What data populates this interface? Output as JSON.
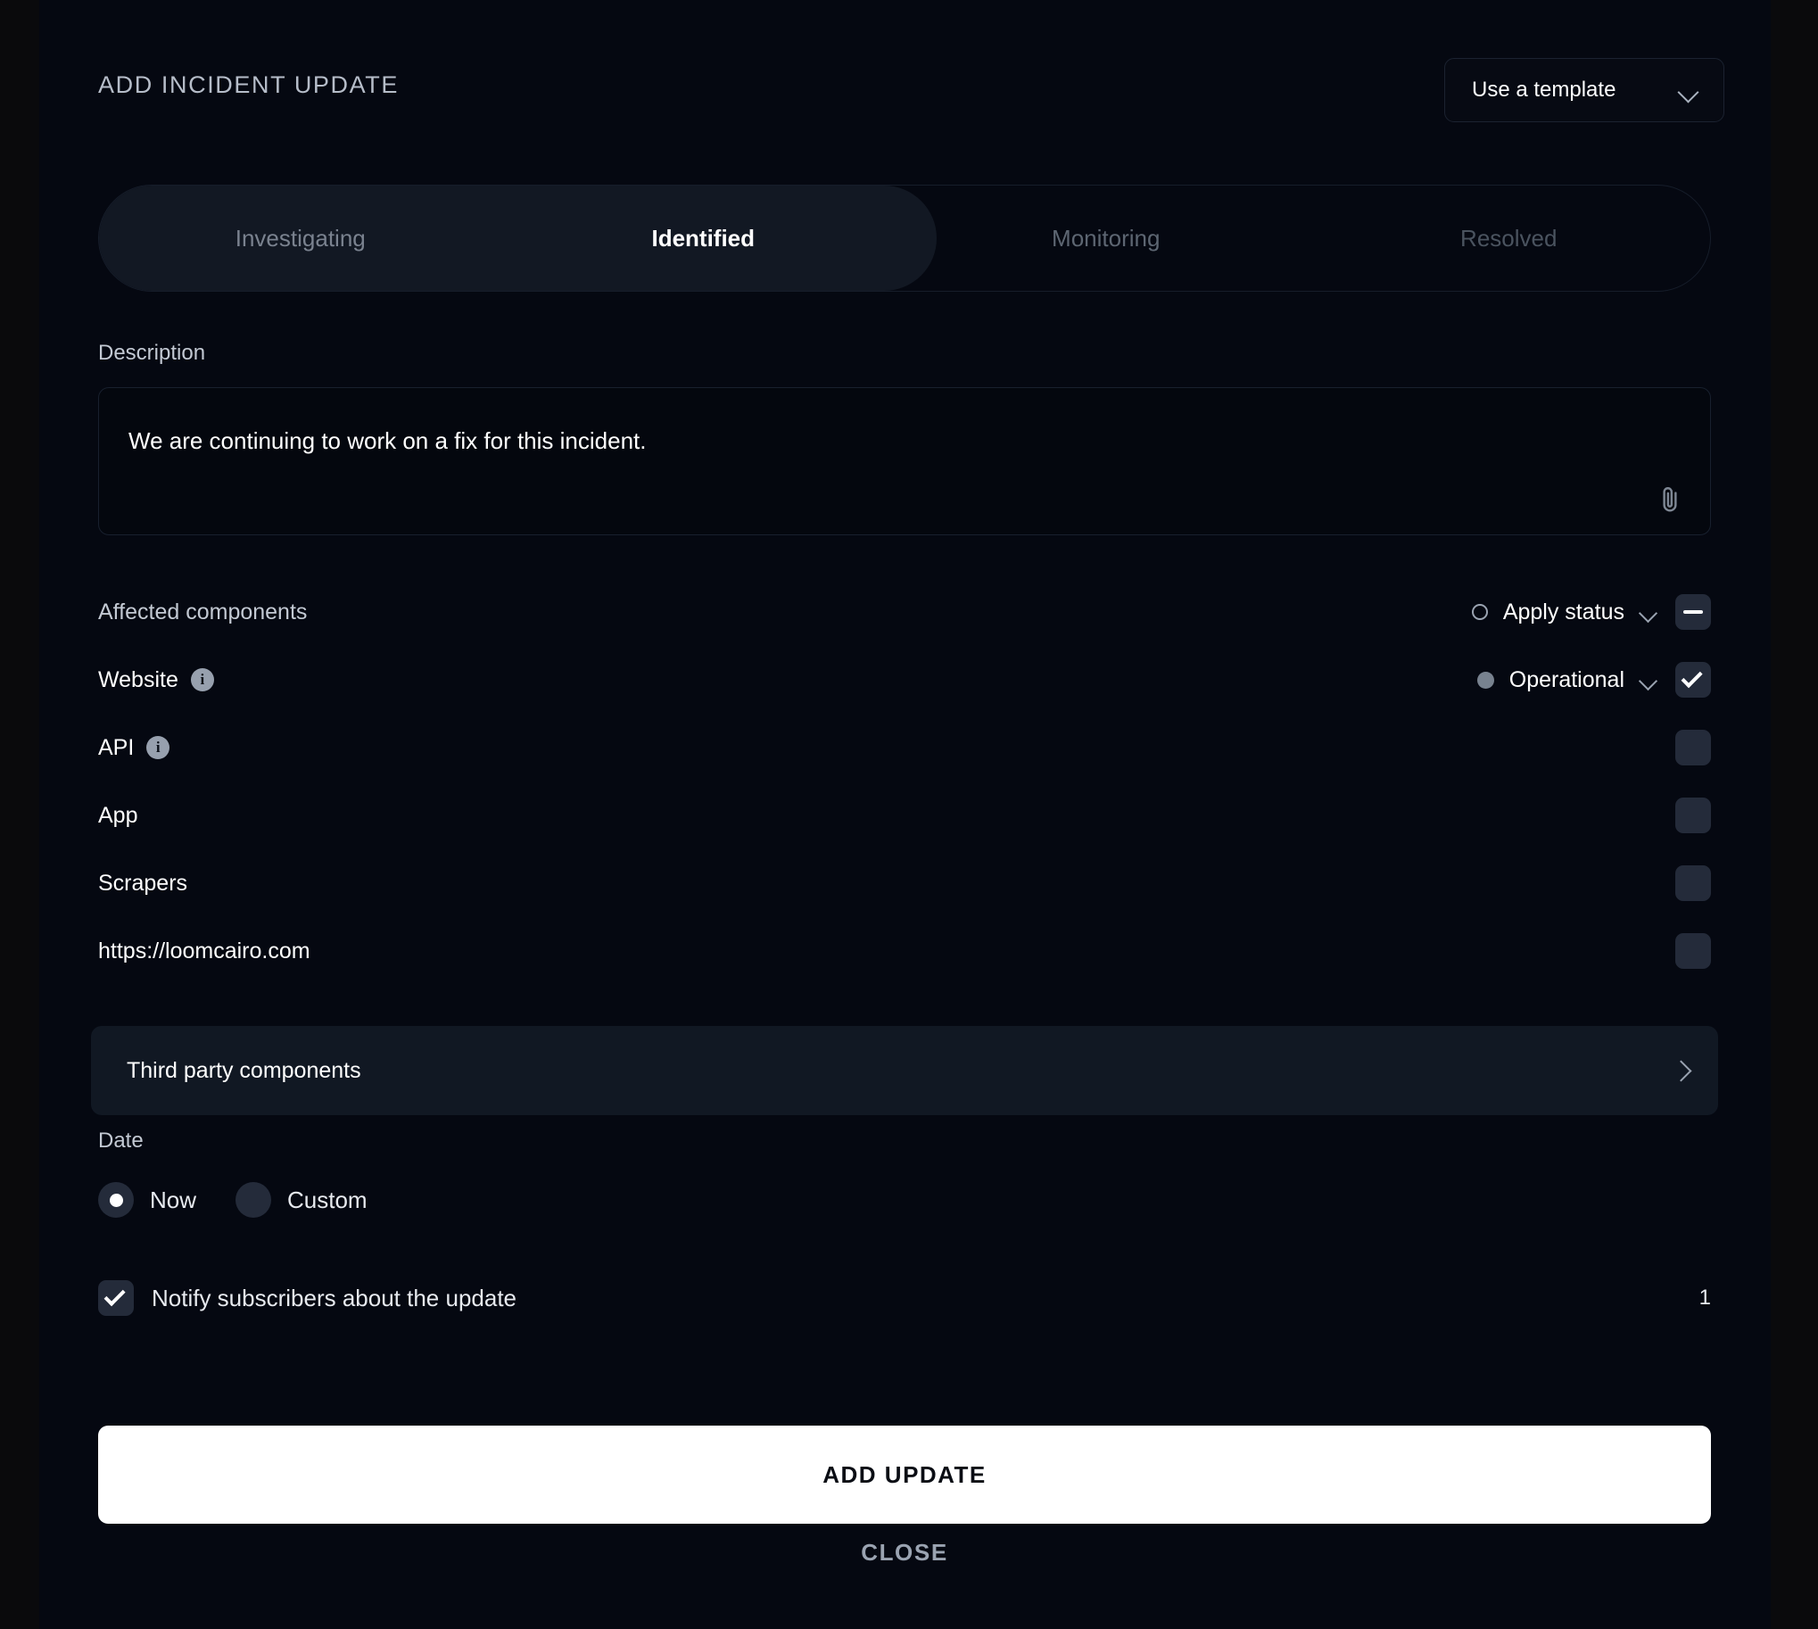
{
  "header": {
    "title": "ADD INCIDENT UPDATE",
    "template_button": {
      "label": "Use a template",
      "icon": "chevron-down-icon"
    }
  },
  "tabs": [
    {
      "label": "Investigating",
      "active": false
    },
    {
      "label": "Identified",
      "active": true
    },
    {
      "label": "Monitoring",
      "active": false
    },
    {
      "label": "Resolved",
      "active": false
    }
  ],
  "description": {
    "label": "Description",
    "value": "We are continuing to work on a fix for this incident.",
    "attachment_icon": "paperclip-icon"
  },
  "components": {
    "label": "Affected components",
    "apply_status": {
      "label": "Apply status",
      "dot": "hollow",
      "checkbox": "indeterminate"
    },
    "rows": [
      {
        "name": "Website",
        "has_info": true,
        "status": "Operational",
        "dot": "filled",
        "checkbox": "checked"
      },
      {
        "name": "API",
        "has_info": true,
        "status": "",
        "dot": "",
        "checkbox": "unchecked"
      },
      {
        "name": "App",
        "has_info": false,
        "status": "",
        "dot": "",
        "checkbox": "unchecked"
      },
      {
        "name": "Scrapers",
        "has_info": false,
        "status": "",
        "dot": "",
        "checkbox": "unchecked"
      },
      {
        "name": "https://loomcairo.com",
        "has_info": false,
        "status": "",
        "dot": "",
        "checkbox": "unchecked"
      }
    ]
  },
  "third_party": {
    "label": "Third party components",
    "icon": "chevron-right-icon"
  },
  "date": {
    "label": "Date",
    "options": [
      {
        "label": "Now",
        "selected": true
      },
      {
        "label": "Custom",
        "selected": false
      }
    ]
  },
  "notify": {
    "label": "Notify subscribers about the update",
    "checked": true,
    "count": "1"
  },
  "footer": {
    "submit_label": "ADD UPDATE",
    "close_label": "CLOSE"
  },
  "colors": {
    "page_background": "#0a0a0c",
    "panel_background": "#050811",
    "accent_white": "#ffffff",
    "checkbox_idle": "#242b3a",
    "muted_text": "#9aa3b1"
  }
}
